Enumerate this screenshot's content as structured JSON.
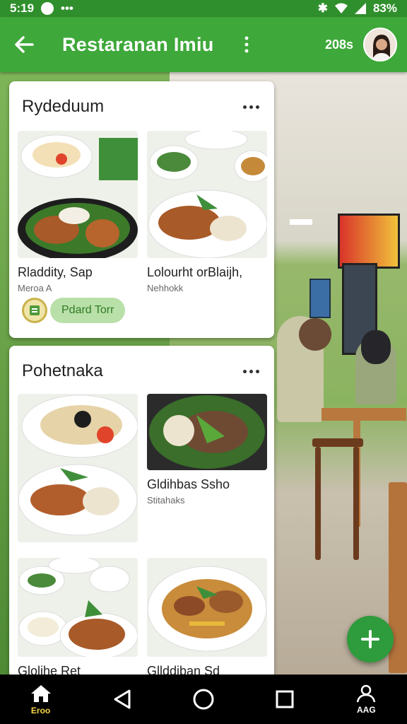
{
  "status_bar": {
    "time": "5:19",
    "battery": "83%"
  },
  "app_bar": {
    "title": "Restaranan Imiu",
    "count": "208s"
  },
  "cards": [
    {
      "title": "Rydeduum",
      "dishes": [
        {
          "name": "Rladdity, Sap",
          "sub": "Meroa A"
        },
        {
          "name": "Lolourht orBlaijh,",
          "sub": "Nehhokk"
        }
      ],
      "chip_label": "Pdard Torr"
    },
    {
      "title": "Pohetnaka",
      "dishes": [
        {
          "name": "",
          "sub": ""
        },
        {
          "name": "Gldihbas Ssho",
          "sub": "Stitahaks"
        },
        {
          "name": "Glolihe Ret",
          "sub": ""
        },
        {
          "name": "Gllddiban Sd",
          "sub": ""
        }
      ]
    }
  ],
  "bottom_nav": {
    "home_label": "Eroo",
    "account_label": "AAG"
  },
  "colors": {
    "primary": "#3ea83a",
    "primary_dark": "#2f8f2c",
    "fab": "#2e9b3c",
    "chip_bg": "#b9e0a8",
    "chip_text": "#2e7a24"
  },
  "icons": {
    "back": "arrow-left-icon",
    "menu": "kebab-icon",
    "more": "more-horizontal-icon",
    "fab": "plus-icon"
  }
}
